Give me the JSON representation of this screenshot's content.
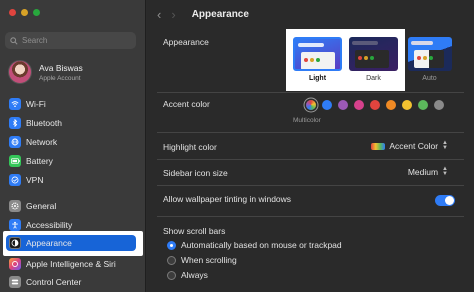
{
  "sidebar": {
    "search_placeholder": "Search",
    "account": {
      "name": "Ava Biswas",
      "subtitle": "Apple Account"
    },
    "items": [
      {
        "label": "Wi-Fi",
        "icon": "wifi-icon"
      },
      {
        "label": "Bluetooth",
        "icon": "bluetooth-icon"
      },
      {
        "label": "Network",
        "icon": "network-icon"
      },
      {
        "label": "Battery",
        "icon": "battery-icon"
      },
      {
        "label": "VPN",
        "icon": "vpn-icon"
      },
      {
        "label": "General",
        "icon": "gear-icon"
      },
      {
        "label": "Accessibility",
        "icon": "accessibility-icon"
      },
      {
        "label": "Appearance",
        "icon": "appearance-icon",
        "selected": true
      },
      {
        "label": "Apple Intelligence & Siri",
        "icon": "siri-icon"
      },
      {
        "label": "Control Center",
        "icon": "control-center-icon"
      }
    ]
  },
  "header": {
    "title": "Appearance"
  },
  "appearance": {
    "label": "Appearance",
    "options": [
      {
        "label": "Light",
        "selected": true
      },
      {
        "label": "Dark"
      },
      {
        "label": "Auto"
      }
    ]
  },
  "accent": {
    "label": "Accent color",
    "caption": "Multicolor",
    "colors": [
      "#8e5bd6",
      "#2f7cf6",
      "#9b59b6",
      "#d6418c",
      "#e0443e",
      "#f08a24",
      "#f2c230",
      "#5cb85c",
      "#8a8a8a"
    ]
  },
  "highlight": {
    "label": "Highlight color",
    "value": "Accent Color"
  },
  "sidebar_icon_size": {
    "label": "Sidebar icon size",
    "value": "Medium"
  },
  "wallpaper_tinting": {
    "label": "Allow wallpaper tinting in windows",
    "enabled": true
  },
  "scroll_bars": {
    "label": "Show scroll bars",
    "options": [
      {
        "label": "Automatically based on mouse or trackpad",
        "selected": true
      },
      {
        "label": "When scrolling"
      },
      {
        "label": "Always"
      }
    ]
  },
  "colors": {
    "accent": "#2f7cf6",
    "selection": "#1764d7"
  }
}
